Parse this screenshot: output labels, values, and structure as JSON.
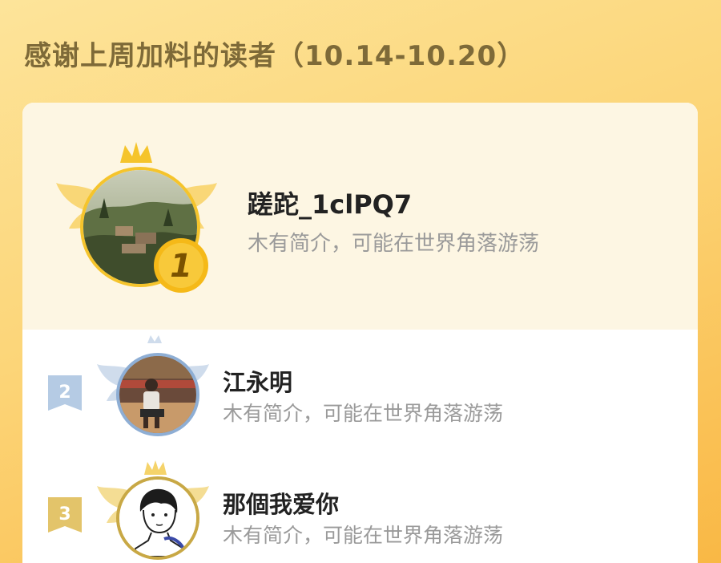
{
  "header": {
    "title": "感谢上周加料的读者（10.14-10.20）"
  },
  "ranking": [
    {
      "rank": "1",
      "name": "蹉跎_1clPQ7",
      "bio": "木有简介，可能在世界角落游荡",
      "avatar": "landscape-photo-avatar"
    },
    {
      "rank": "2",
      "name": "江永明",
      "bio": "木有简介，可能在世界角落游荡",
      "avatar": "basketball-player-avatar"
    },
    {
      "rank": "3",
      "name": "那個我爱你",
      "bio": "木有简介，可能在世界角落游荡",
      "avatar": "anime-boy-avatar"
    }
  ],
  "colors": {
    "gold": "#f5c42c",
    "silver": "#a9c3de",
    "bronze": "#e3c46a",
    "title": "#7e6a38",
    "bio": "#9a9a9a"
  }
}
